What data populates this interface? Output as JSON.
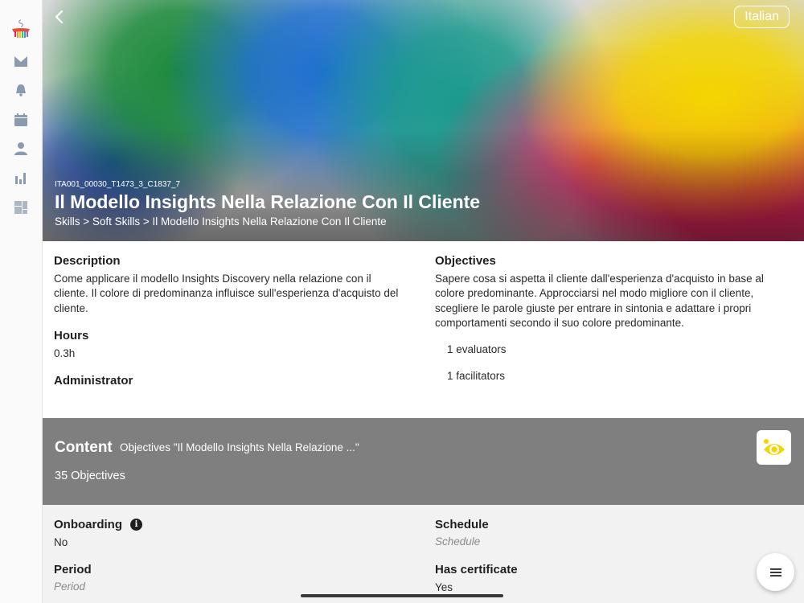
{
  "header": {
    "language_label": "Italian",
    "course_code": "ITA001_00030_T1473_3_C1837_7",
    "title": "Il Modello Insights Nella Relazione Con Il Cliente",
    "breadcrumb": "Skills > Soft Skills > Il Modello Insights Nella Relazione Con Il Cliente"
  },
  "details": {
    "description_label": "Description",
    "description_line1": "Come applicare il modello Insights Discovery nella relazione con il",
    "description_line2": "cliente. Il colore di predominanza influisce sull'esperienza d'acquisto del",
    "description_line3": "cliente.",
    "hours_label": "Hours",
    "hours_value": "0.3h",
    "administrator_label": "Administrator",
    "objectives_label": "Objectives",
    "objectives_line1": "Sapere cosa si aspetta il cliente dall'esperienza d'acquisto in base al",
    "objectives_line2": "colore predominante. Approcciarsi nel modo migliore con il cliente,",
    "objectives_line3": "scegliere le parole giuste per entrare in sintonia e adattare i propri",
    "objectives_line4": "comportamenti secondo il suo colore predominante.",
    "evaluators": "1 evaluators",
    "facilitators": "1 facilitators"
  },
  "content": {
    "title": "Content",
    "subtitle": "Objectives \"Il Modello Insights Nella Relazione ...\"",
    "count": "35 Objectives"
  },
  "settings": {
    "onboarding_label": "Onboarding",
    "onboarding_value": "No",
    "period_label": "Period",
    "period_placeholder": "Period",
    "schedule_label": "Schedule",
    "schedule_placeholder": "Schedule",
    "certificate_label": "Has certificate",
    "certificate_value": "Yes"
  },
  "icons": {
    "sidebar": [
      "logo-icon",
      "mail-icon",
      "bell-icon",
      "calendar-icon",
      "user-icon",
      "bar-chart-icon",
      "dashboard-icon"
    ],
    "back": "chevron-left-icon",
    "eye": "eye-icon",
    "menu": "menu-icon",
    "info": "info-icon"
  },
  "colors": {
    "sidebar_icon": "#8a9bb0",
    "content_band": "#7f7f7f",
    "eye_accent": "#f5d400"
  }
}
